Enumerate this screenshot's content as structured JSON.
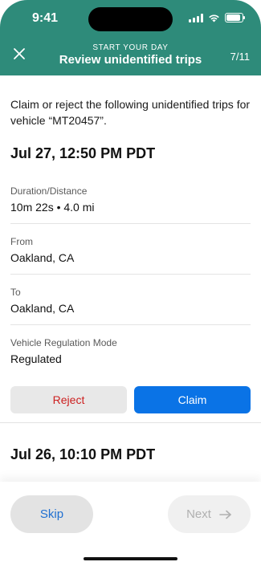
{
  "status_bar": {
    "time": "9:41"
  },
  "header": {
    "kicker": "START YOUR DAY",
    "title": "Review unidentified trips",
    "counter": "7/11",
    "background_color": "#2E8B7A"
  },
  "intro_text": "Claim or reject the following unidentified trips for vehicle “MT20457”.",
  "trip": {
    "date": "Jul 27, 12:50 PM PDT",
    "fields": [
      {
        "label": "Duration/Distance",
        "value": "10m 22s • 4.0 mi"
      },
      {
        "label": "From",
        "value": "Oakland, CA"
      },
      {
        "label": "To",
        "value": "Oakland, CA"
      },
      {
        "label": "Vehicle Regulation Mode",
        "value": "Regulated"
      }
    ],
    "reject_label": "Reject",
    "claim_label": "Claim"
  },
  "next_trip": {
    "date": "Jul 26, 10:10 PM PDT"
  },
  "footer": {
    "skip_label": "Skip",
    "next_label": "Next",
    "next_icon": "arrow-right-icon"
  },
  "colors": {
    "primary": "#0A73E6",
    "danger": "#CC1F1F"
  }
}
